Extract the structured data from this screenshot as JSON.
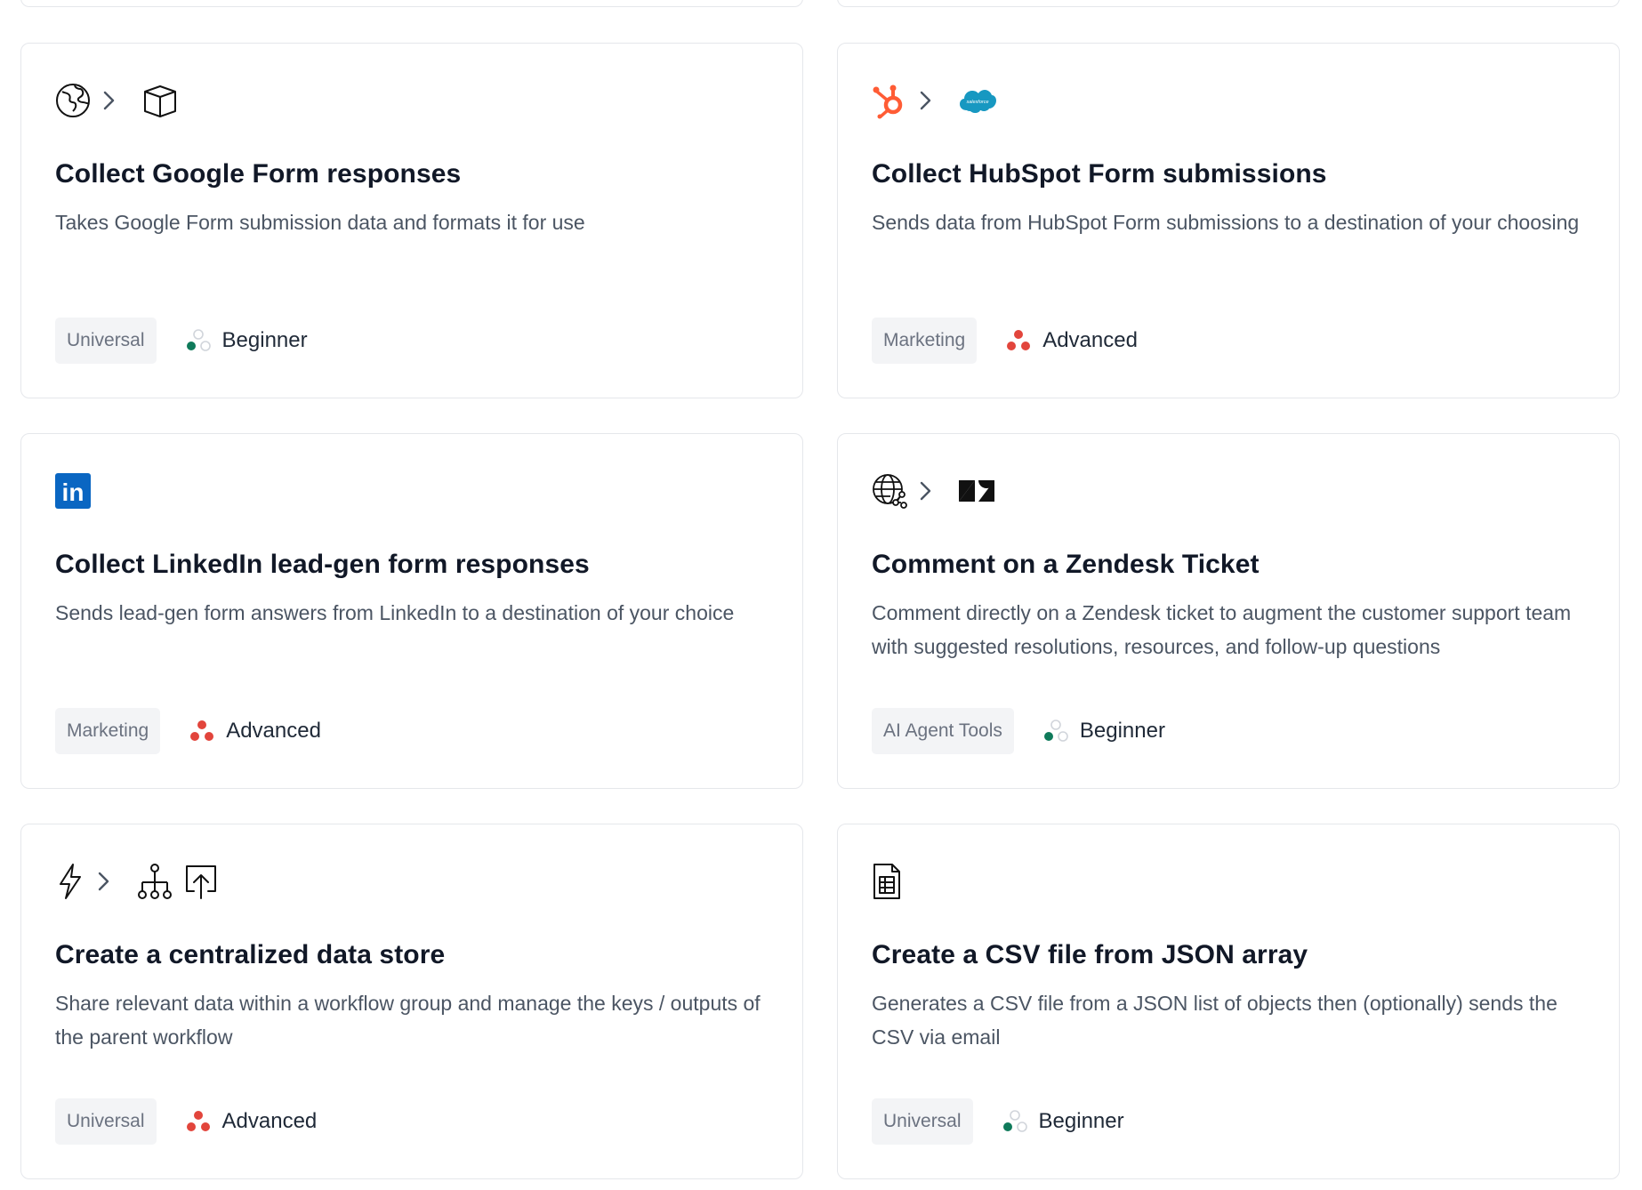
{
  "colors": {
    "advanced": "#e2453c",
    "beginner_on": "#0f7a5a",
    "beginner_off": "#d1d5db",
    "hubspot": "#ff5c35",
    "salesforce": "#1798c1",
    "linkedin": "#0a66c2"
  },
  "cards": [
    {
      "title": "Collect Google Form responses",
      "description": "Takes Google Form submission data and formats it for use",
      "category": "Universal",
      "level": "Beginner",
      "icons": [
        "globe-icon",
        "chevron-right-icon",
        "box-icon"
      ]
    },
    {
      "title": "Collect HubSpot Form submissions",
      "description": "Sends data from HubSpot Form submissions to a destination of your choosing",
      "category": "Marketing",
      "level": "Advanced",
      "icons": [
        "hubspot-icon",
        "chevron-right-icon",
        "salesforce-icon"
      ],
      "logo_text": "salesforce"
    },
    {
      "title": "Collect LinkedIn lead-gen form responses",
      "description": "Sends lead-gen form answers from LinkedIn to a destination of your choice",
      "category": "Marketing",
      "level": "Advanced",
      "icons": [
        "linkedin-icon"
      ],
      "logo_text": "in"
    },
    {
      "title": "Comment on a Zendesk Ticket",
      "description": "Comment directly on a Zendesk ticket to augment the customer support team with suggested resolutions, resources, and follow-up questions",
      "category": "AI Agent Tools",
      "level": "Beginner",
      "icons": [
        "web-network-icon",
        "chevron-right-icon",
        "zendesk-icon"
      ]
    },
    {
      "title": "Create a centralized data store",
      "description": "Share relevant data within a workflow group and manage the keys / outputs of the parent workflow",
      "category": "Universal",
      "level": "Advanced",
      "icons": [
        "lightning-icon",
        "chevron-right-icon",
        "hierarchy-icon",
        "upload-box-icon"
      ]
    },
    {
      "title": "Create a CSV file from JSON array",
      "description": "Generates a CSV file from a JSON list of objects then (optionally) sends the CSV via email",
      "category": "Universal",
      "level": "Beginner",
      "icons": [
        "spreadsheet-file-icon"
      ]
    }
  ]
}
